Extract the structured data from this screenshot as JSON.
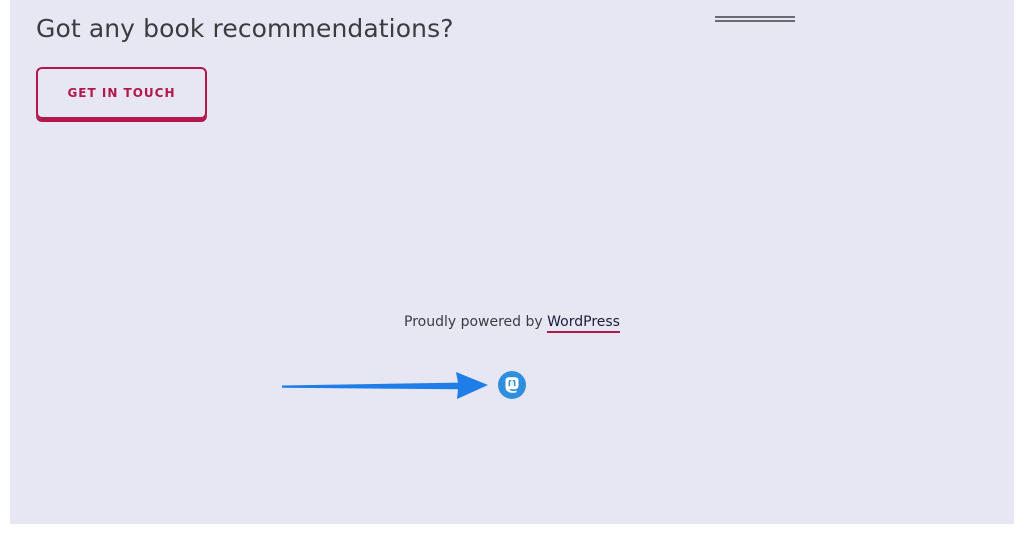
{
  "page": {
    "heading": "Got any book recommendations?",
    "cta_label": "GET IN TOUCH"
  },
  "footer": {
    "credit_prefix": "Proudly powered by",
    "credit_link": "WordPress",
    "social_icon": "mastodon-icon"
  },
  "annotation": {
    "arrow_icon": "arrow-right-icon"
  },
  "colors": {
    "background": "#e6e7f3",
    "accent": "#b2184a",
    "text": "#3c3c40",
    "mastodon": "#2f8fde",
    "arrow": "#1e7de8"
  }
}
